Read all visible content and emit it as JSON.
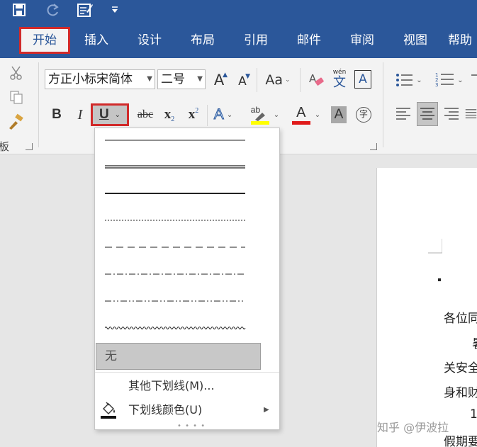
{
  "quick_access": {
    "save_icon": "save-icon",
    "redo_icon": "redo-icon",
    "form_icon": "form-icon",
    "customize_icon": "customize-icon"
  },
  "tabs": [
    {
      "label": "开始",
      "active": true
    },
    {
      "label": "插入"
    },
    {
      "label": "设计"
    },
    {
      "label": "布局"
    },
    {
      "label": "引用"
    },
    {
      "label": "邮件"
    },
    {
      "label": "审阅"
    },
    {
      "label": "视图"
    },
    {
      "label": "帮助"
    }
  ],
  "clipboard": {
    "label": "板"
  },
  "font": {
    "name": "方正小标宋简体",
    "size": "二号",
    "phonetic_top": "wén",
    "phonetic_bottom": "文",
    "border_char": "A",
    "grow": "A",
    "shrink": "A",
    "case": "Aa",
    "bold": "B",
    "italic": "I",
    "underline": "U",
    "strike": "abc",
    "sub": "x",
    "sub_mark": "2",
    "sup": "x",
    "sup_mark": "2",
    "effects": "A",
    "highlight": "ab",
    "color_a": "A",
    "shade_a": "A",
    "enclose": "字"
  },
  "underline_menu": {
    "none_label": "无",
    "more_label": "其他下划线(M)...",
    "color_label": "下划线颜色(U)"
  },
  "document": {
    "lines": [
      "各位同",
      "暑",
      "关安全",
      "身和财",
      "1.",
      "假期要"
    ]
  },
  "watermark": "知乎 @伊波拉",
  "colors": {
    "brand": "#2b579a",
    "highlight_red": "#d12a2a",
    "highlight_yellow": "#ffff00",
    "font_color_red": "#e01b1b"
  }
}
